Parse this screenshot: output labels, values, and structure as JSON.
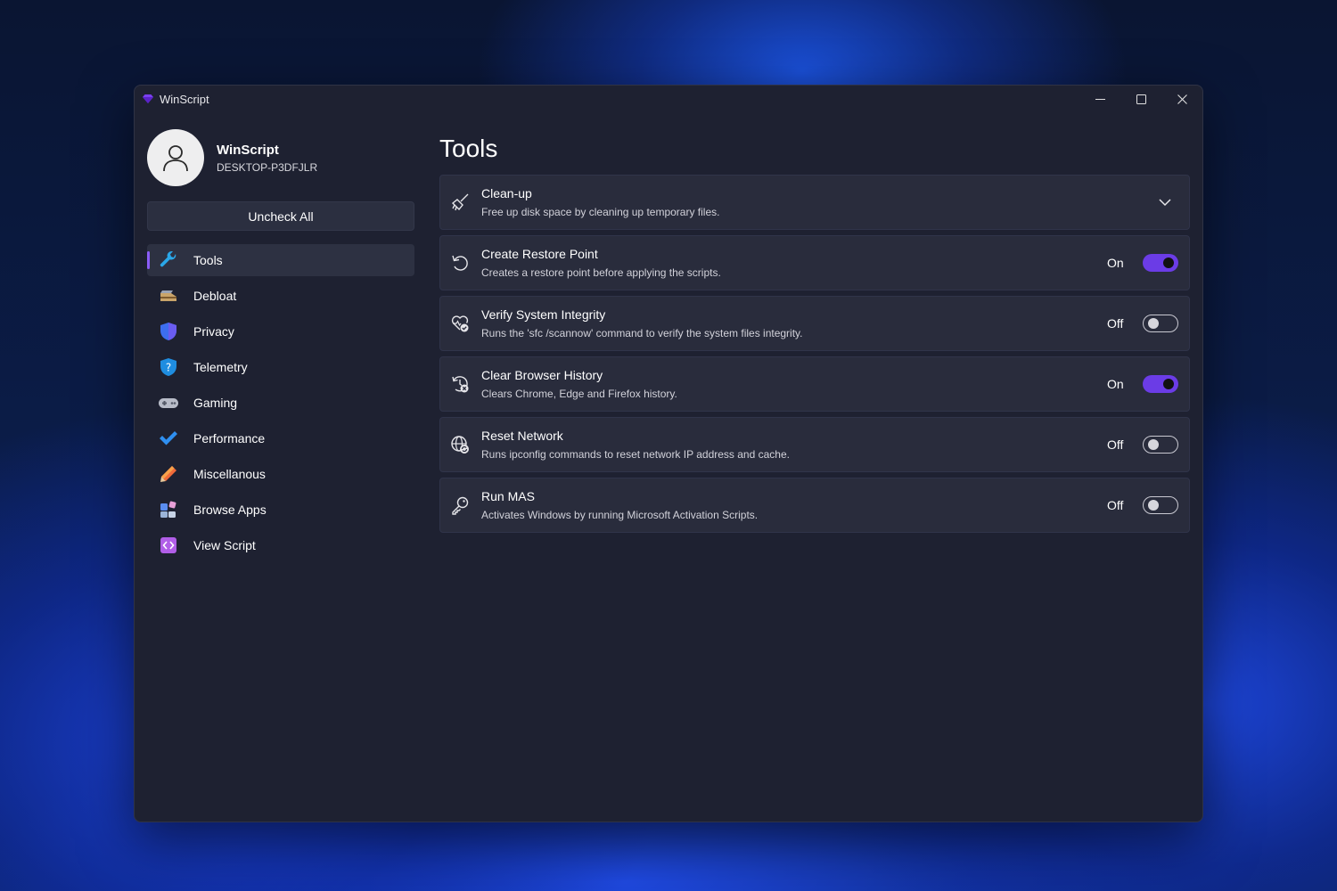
{
  "window": {
    "title": "WinScript"
  },
  "profile": {
    "name": "WinScript",
    "host": "DESKTOP-P3DFJLR"
  },
  "sidebar": {
    "uncheck_all": "Uncheck All",
    "items": [
      {
        "label": "Tools",
        "icon": "wrench-icon",
        "active": true
      },
      {
        "label": "Debloat",
        "icon": "broom-icon"
      },
      {
        "label": "Privacy",
        "icon": "shield-icon"
      },
      {
        "label": "Telemetry",
        "icon": "shield-question-icon"
      },
      {
        "label": "Gaming",
        "icon": "gamepad-icon"
      },
      {
        "label": "Performance",
        "icon": "checkmark-icon"
      },
      {
        "label": "Miscellanous",
        "icon": "pencil-icon"
      },
      {
        "label": "Browse Apps",
        "icon": "apps-icon"
      },
      {
        "label": "View Script",
        "icon": "code-icon"
      }
    ]
  },
  "main": {
    "title": "Tools",
    "cards": [
      {
        "title": "Clean-up",
        "desc": "Free up disk space by cleaning up temporary files.",
        "icon": "broom-outline-icon",
        "control": "expand"
      },
      {
        "title": "Create Restore Point",
        "desc": "Creates a restore point before applying the scripts.",
        "icon": "undo-icon",
        "state": "On"
      },
      {
        "title": "Verify System Integrity",
        "desc": "Runs the 'sfc /scannow' command to verify the system files integrity.",
        "icon": "heart-check-icon",
        "state": "Off"
      },
      {
        "title": "Clear Browser History",
        "desc": "Clears Chrome, Edge and Firefox history.",
        "icon": "history-clear-icon",
        "state": "On"
      },
      {
        "title": "Reset Network",
        "desc": "Runs ipconfig commands to reset network IP address and cache.",
        "icon": "globe-refresh-icon",
        "state": "Off"
      },
      {
        "title": "Run MAS",
        "desc": "Activates Windows by running Microsoft Activation Scripts.",
        "icon": "key-icon",
        "state": "Off"
      }
    ]
  },
  "colors": {
    "accent": "#6b3ce6",
    "window_bg": "#1e2131",
    "card_bg": "#292c3c"
  }
}
